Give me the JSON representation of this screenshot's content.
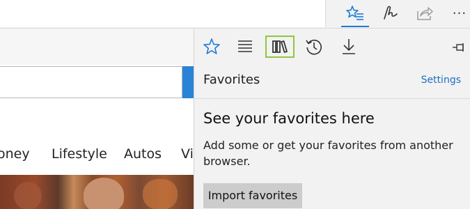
{
  "toolbar": {
    "icons": [
      "favorites-hub-icon",
      "pen-icon",
      "share-icon",
      "more-icon"
    ],
    "more_label": "···",
    "accent_color": "#1e7bd6"
  },
  "page": {
    "nav_items": [
      "oney",
      "Lifestyle",
      "Autos",
      "Vi"
    ],
    "search_button_color": "#2a83d6"
  },
  "hub": {
    "tabs": [
      "favorites-tab",
      "reading-list-tab",
      "books-tab",
      "history-tab",
      "downloads-tab"
    ],
    "selected_tab": "favorites-tab",
    "highlighted_tab": "books-tab",
    "highlight_color": "#8dc63f",
    "title": "Favorites",
    "settings_label": "Settings",
    "empty_title": "See your favorites here",
    "empty_description": "Add some or get your favorites from another browser.",
    "import_button_label": "Import favorites"
  }
}
